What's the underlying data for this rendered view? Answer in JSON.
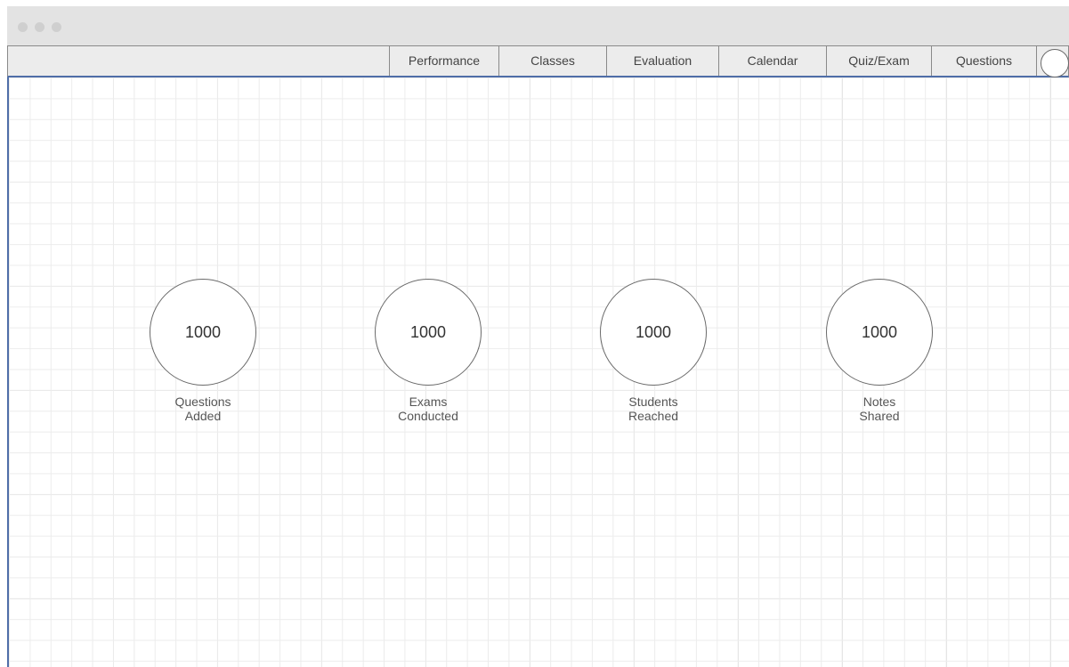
{
  "navbar": {
    "items": [
      {
        "label": "Performance"
      },
      {
        "label": "Classes"
      },
      {
        "label": "Evaluation"
      },
      {
        "label": "Calendar"
      },
      {
        "label": "Quiz/Exam"
      },
      {
        "label": "Questions"
      }
    ]
  },
  "stats": [
    {
      "value": "1000",
      "label": "Questions\nAdded"
    },
    {
      "value": "1000",
      "label": "Exams\nConducted"
    },
    {
      "value": "1000",
      "label": "Students\nReached"
    },
    {
      "value": "1000",
      "label": "Notes\nShared"
    }
  ],
  "colors": {
    "titlebar": "#e3e3e3",
    "navbar": "#ececec",
    "accent_border": "#4f6ea8",
    "grid": "#ececec"
  }
}
